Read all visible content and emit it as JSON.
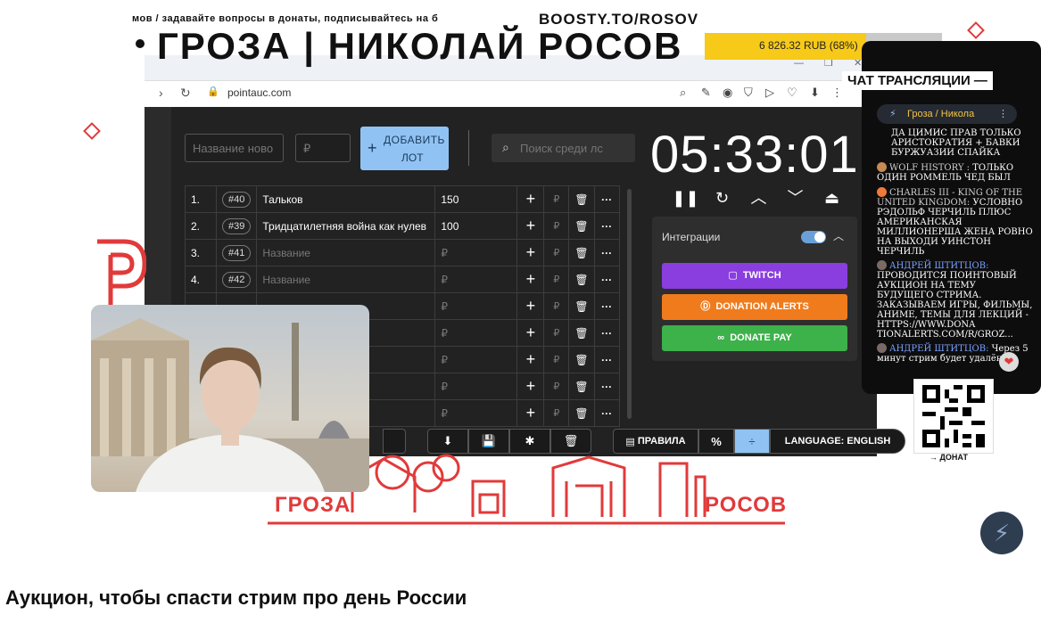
{
  "stream": {
    "ticker": "мов / задавайте вопросы в донаты, подписывайтесь на б",
    "boosty": "BOOSTY.TO/ROSOV",
    "title": "ГРОЗА | НИКОЛАЙ РОСОВ",
    "donation_text": "6 826.32 RUB (68%)",
    "donation_progress": 0.68,
    "logo_left": "ГРОЗА",
    "logo_right": "РОСОВ",
    "donate_label": "→ ДОНАТ"
  },
  "browser": {
    "url": "pointauc.com",
    "window_controls": "— ❐ ✕"
  },
  "auction": {
    "name_placeholder": "Название ново",
    "amount_placeholder": "₽",
    "add_button_line1": "ДОБАВИТЬ",
    "add_button_line2": "ЛОТ",
    "search_placeholder": "Поиск среди лс",
    "timer": "05:33:01",
    "currency": "₽",
    "lots": [
      {
        "n": "1.",
        "id": "#40",
        "name": "Тальков",
        "amount": "150",
        "placeholder": false
      },
      {
        "n": "2.",
        "id": "#39",
        "name": "Тридцатилетняя война как нулев",
        "amount": "100",
        "placeholder": false
      },
      {
        "n": "3.",
        "id": "#41",
        "name": "Название",
        "amount": "₽",
        "placeholder": true
      },
      {
        "n": "4.",
        "id": "#42",
        "name": "Название",
        "amount": "₽",
        "placeholder": true
      },
      {
        "n": "",
        "id": "",
        "name": "",
        "amount": "₽",
        "placeholder": true
      },
      {
        "n": "",
        "id": "",
        "name": "",
        "amount": "₽",
        "placeholder": true
      },
      {
        "n": "",
        "id": "",
        "name": "",
        "amount": "₽",
        "placeholder": true
      },
      {
        "n": "",
        "id": "",
        "name": "",
        "amount": "₽",
        "placeholder": true
      },
      {
        "n": "",
        "id": "",
        "name": "",
        "amount": "₽",
        "placeholder": true
      }
    ],
    "integrations_label": "Интеграции",
    "twitch_label": "TWITCH",
    "donation_alerts_label": "DONATION ALERTS",
    "donate_pay_label": "DONATE PAY",
    "rules_label": "ПРАВИЛА",
    "percent_label": "%",
    "language_label": "LANGUAGE: ENGLISH",
    "colors": {
      "twitch": "#8a3ee0",
      "donation_alerts": "#f07b1c",
      "donate_pay": "#3db14a",
      "add_button": "#90c3f3"
    }
  },
  "chat": {
    "title": "ЧАТ ТРАНСЛЯЦИИ —",
    "channel": "Гроза / Никола",
    "messages": [
      {
        "author": "",
        "text": "ДА ЦИМИС ПРАВ ТОЛЬКО АРИСТОКРАТИЯ + БАВКИ БУРЖУАЗИИ СПАЙКА"
      },
      {
        "author": "WOLF HISTORY :",
        "text": "ТОЛЬКО ОДИН РОММЕЛЬ ЧЕД БЫЛ"
      },
      {
        "author": "CHARLES III - KING OF THE UNITED KINGDOM:",
        "text": "УСЛОВНО РЭДОЛЬФ ЧЕРЧИЛЬ ПЛЮС АМЕРИКАНСКАЯ МИЛЛИОНЕРША ЖЕНА РОВНО НА ВЫХОДИ УИНСТОН ЧЕРЧИЛЬ"
      },
      {
        "author": "АНДРЕЙ ШТИТЦОВ:",
        "text": "ПРОВОДИТСЯ ПОИНТОВЫЙ АУКЦИОН НА ТЕМУ БУДУЩЕГО СТРИМА. ЗАКАЗЫВАЕМ ИГРЫ, ФИЛЬМЫ, АНИМЕ, ТЕМЫ ДЛЯ ЛЕКЦИЙ - HTTPS://WWW.DONA TIONALERTS.COM/R/GROZ..."
      },
      {
        "author": "АНДРЕЙ ШТИТЦОВ:",
        "text": "Через 5 минут стрим будет удалён"
      }
    ]
  },
  "video": {
    "caption": "Аукцион, чтобы спасти стрим про день России"
  }
}
